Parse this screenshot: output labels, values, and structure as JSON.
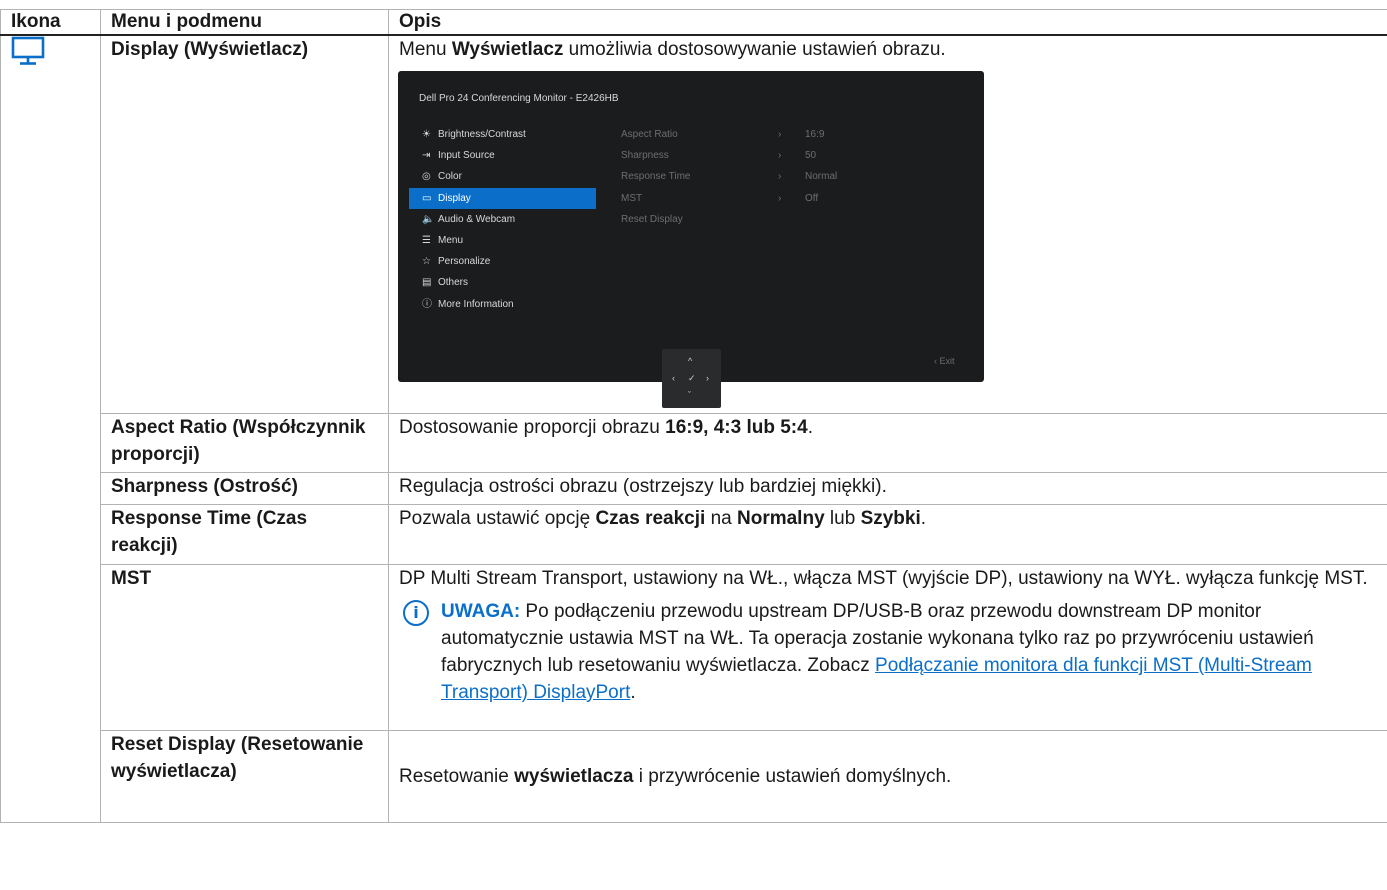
{
  "header": {
    "col_icon": "Ikona",
    "col_menu": "Menu i podmenu",
    "col_desc": "Opis"
  },
  "display_row": {
    "icon": "monitor-icon",
    "name": "Display (Wyświetlacz)",
    "desc_pre": "Menu ",
    "desc_bold": "Wyświetlacz",
    "desc_post": " umożliwia dostosowywanie ustawień obrazu."
  },
  "osd": {
    "title": "Dell Pro 24 Conferencing Monitor - E2426HB",
    "menu": [
      {
        "icon": "☀",
        "label": "Brightness/Contrast"
      },
      {
        "icon": "⇥",
        "label": "Input Source"
      },
      {
        "icon": "◎",
        "label": "Color"
      },
      {
        "icon": "▭",
        "label": "Display"
      },
      {
        "icon": "🔈",
        "label": "Audio & Webcam"
      },
      {
        "icon": "☰",
        "label": "Menu"
      },
      {
        "icon": "☆",
        "label": "Personalize"
      },
      {
        "icon": "▤",
        "label": "Others"
      },
      {
        "icon": "ⓘ",
        "label": "More Information"
      }
    ],
    "selected_index": 3,
    "submenu": [
      {
        "label": "Aspect Ratio",
        "arrow": "›",
        "value": "16:9"
      },
      {
        "label": "Sharpness",
        "arrow": "›",
        "value": "50"
      },
      {
        "label": "Response Time",
        "arrow": "›",
        "value": "Normal"
      },
      {
        "label": "MST",
        "arrow": "›",
        "value": "Off"
      },
      {
        "label": "Reset Display",
        "arrow": "",
        "value": ""
      }
    ],
    "exit": "‹  Exit",
    "joystick": {
      "up": "^",
      "left": "‹",
      "center": "✓",
      "right": "›",
      "down": "ˇ"
    }
  },
  "rows": {
    "aspect": {
      "name": "Aspect Ratio (Współczynnik proporcji)",
      "desc_pre": "Dostosowanie proporcji obrazu ",
      "desc_bold": "16:9, 4:3 lub 5:4",
      "desc_post": "."
    },
    "sharpness": {
      "name": "Sharpness (Ostrość)",
      "desc": "Regulacja ostrości obrazu (ostrzejszy lub bardziej miękki)."
    },
    "response": {
      "name": "Response Time (Czas reakcji)",
      "desc_1": "Pozwala ustawić opcję ",
      "desc_b1": "Czas reakcji",
      "desc_2": " na ",
      "desc_b2": "Normalny",
      "desc_3": " lub ",
      "desc_b3": "Szybki",
      "desc_4": "."
    },
    "mst": {
      "name": "MST",
      "desc": "DP Multi Stream Transport, ustawiony na WŁ., włącza MST (wyjście DP), ustawiony na WYŁ. wyłącza funkcję MST.",
      "note_icon": "i",
      "note_label": "UWAGA:",
      "note_text": " Po podłączeniu przewodu upstream DP/USB-B oraz przewodu downstream DP monitor automatycznie ustawia MST na WŁ. Ta operacja zostanie wykonana tylko raz po przywróceniu ustawień fabrycznych lub resetowaniu wyświetlacza. Zobacz ",
      "note_link": "Podłączanie monitora dla funkcji MST (Multi-Stream Transport) DisplayPort",
      "note_end": "."
    },
    "reset": {
      "name": "Reset Display (Resetowanie wyświetlacza)",
      "desc_pre": "Resetowanie ",
      "desc_bold": "wyświetlacza",
      "desc_post": " i przywrócenie ustawień domyślnych."
    }
  },
  "colors": {
    "accent": "#0B6FC9",
    "osd_bg": "#1B1C1E",
    "border": "#B3B3B3"
  }
}
